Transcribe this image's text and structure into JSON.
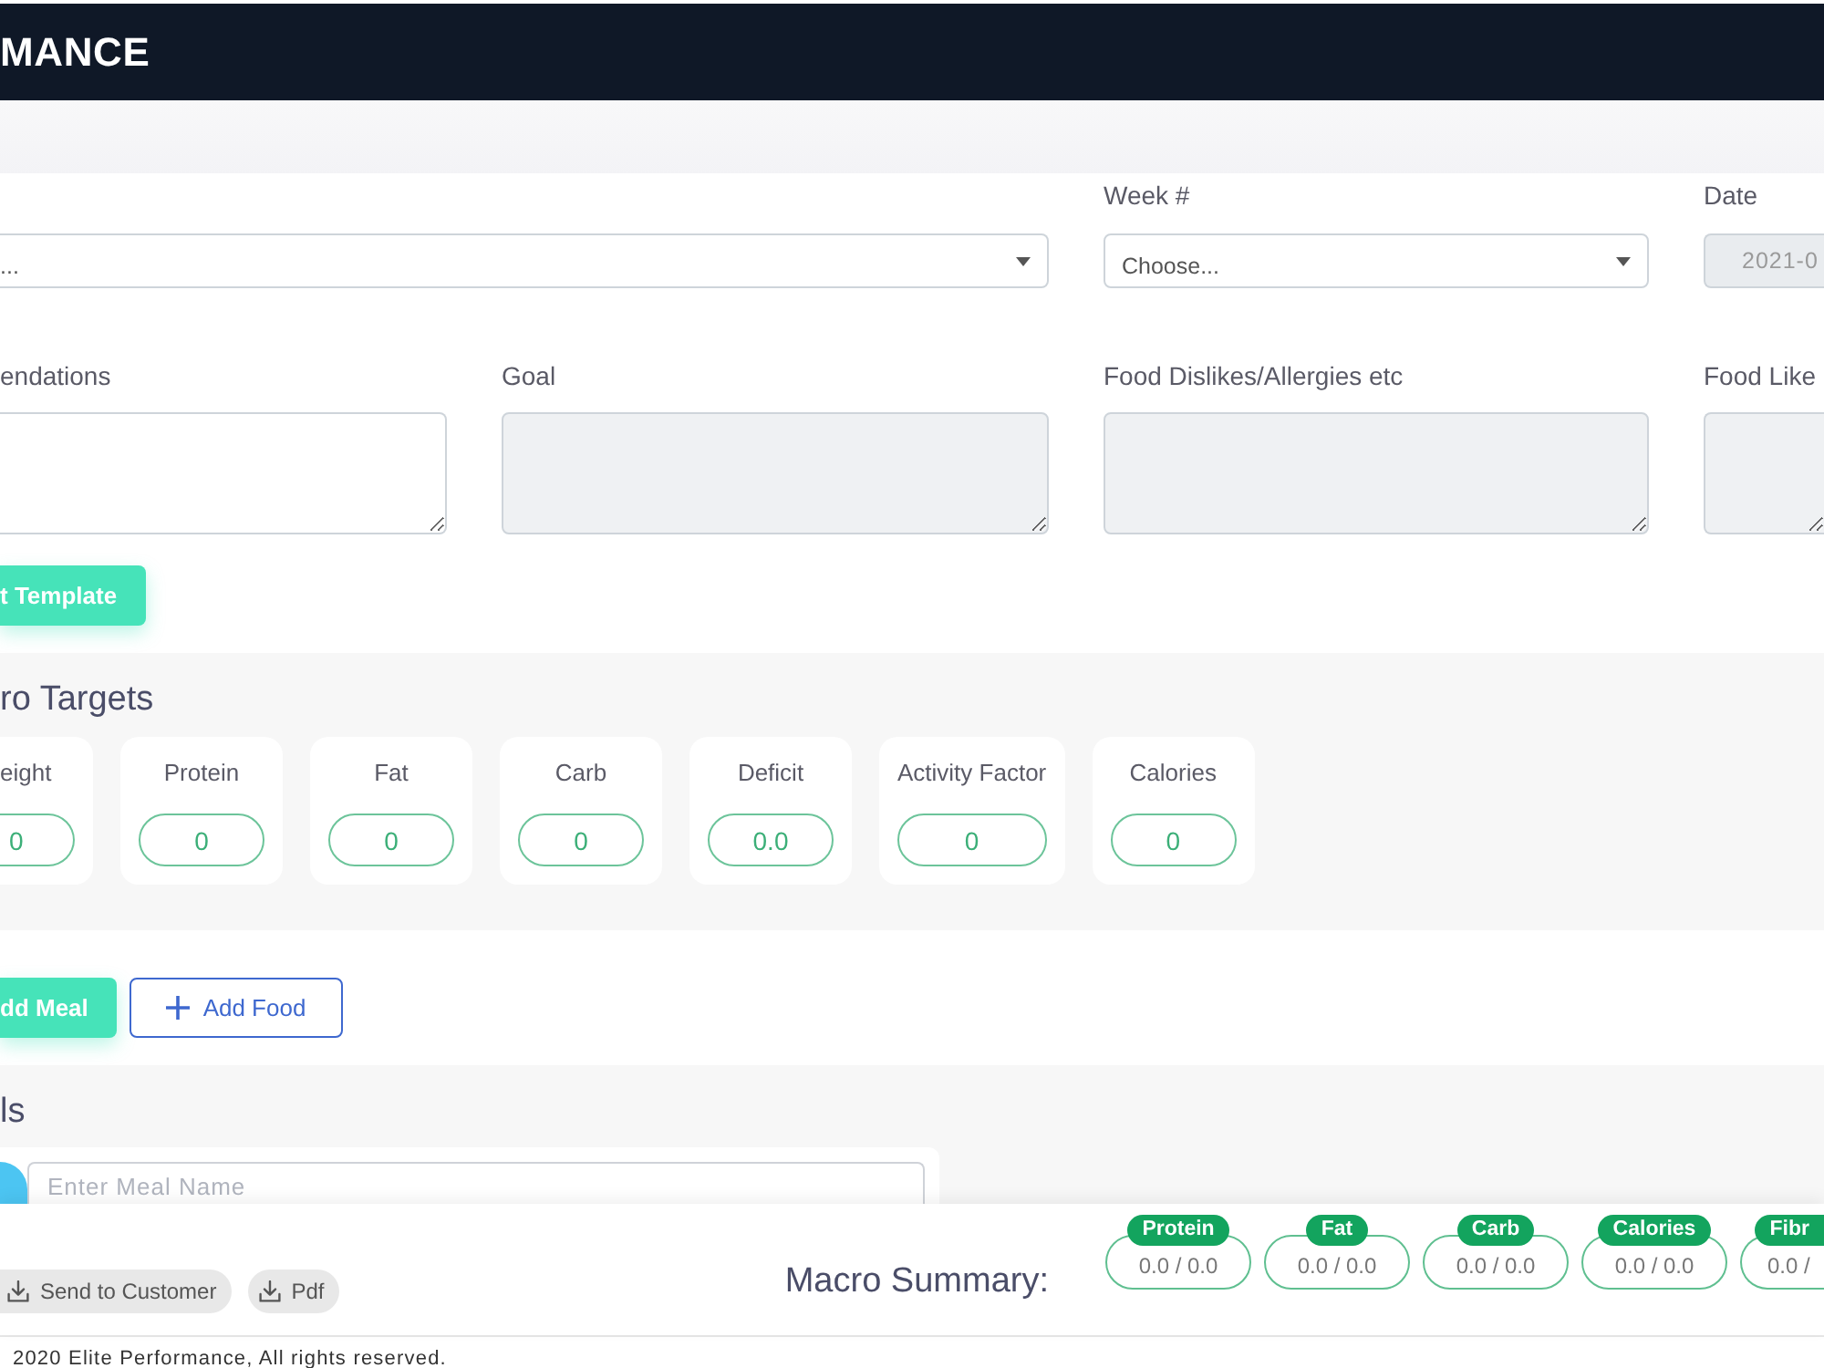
{
  "header": {
    "title": "MANCE"
  },
  "form": {
    "top_row": [
      {
        "kind": "select",
        "value": "...",
        "disabled": false
      },
      {
        "kind": "select",
        "label": "Week #",
        "value": "Choose...",
        "disabled": false
      },
      {
        "kind": "date",
        "label": "Date",
        "value": "2021-0",
        "disabled": true
      }
    ],
    "notes": [
      {
        "label": "endations",
        "disabled": false
      },
      {
        "label": "Goal",
        "disabled": true
      },
      {
        "label": "Food Dislikes/Allergies etc",
        "disabled": true
      },
      {
        "label": "Food Like",
        "disabled": true
      }
    ],
    "template_button": "t Template"
  },
  "macro_targets": {
    "title": "ro Targets",
    "items": [
      {
        "label": "eight",
        "value": "0"
      },
      {
        "label": "Protein",
        "value": "0"
      },
      {
        "label": "Fat",
        "value": "0"
      },
      {
        "label": "Carb",
        "value": "0"
      },
      {
        "label": "Deficit",
        "value": "0.0"
      },
      {
        "label": "Activity Factor",
        "value": "0"
      },
      {
        "label": "Calories",
        "value": "0"
      }
    ]
  },
  "actions": {
    "buttons": [
      {
        "kind": "primary",
        "label": "dd Meal"
      },
      {
        "kind": "outline",
        "label": "Add Food"
      }
    ]
  },
  "meals": {
    "title": "ls",
    "meal_name": {
      "placeholder": "Enter Meal Name"
    }
  },
  "summary_bar": {
    "buttons": [
      {
        "label": "Send to Customer"
      },
      {
        "label": "Pdf"
      }
    ],
    "title": "Macro Summary:",
    "items": [
      {
        "label": "Protein",
        "value": "0.0 / 0.0"
      },
      {
        "label": "Fat",
        "value": "0.0 / 0.0"
      },
      {
        "label": "Carb",
        "value": "0.0 / 0.0"
      },
      {
        "label": "Calories",
        "value": "0.0 / 0.0"
      },
      {
        "label": "Fibr",
        "value": "0.0 /"
      }
    ]
  },
  "footer": {
    "copyright": "2020 Elite Performance, All rights reserved."
  }
}
